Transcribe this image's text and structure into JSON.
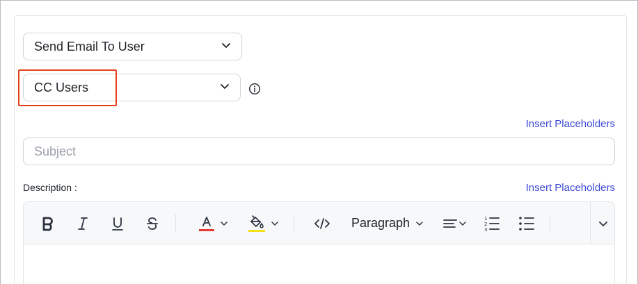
{
  "form": {
    "action_select": {
      "value": "Send Email To User"
    },
    "cc_select": {
      "value": "CC Users"
    },
    "subject": {
      "value": "",
      "placeholder": "Subject"
    },
    "subject_placeholders_link": "Insert Placeholders",
    "description_label": "Description :",
    "description_placeholders_link": "Insert Placeholders"
  },
  "toolbar": {
    "paragraph_label": "Paragraph",
    "text_color_accent": "#e53935",
    "highlight_color_accent": "#f4e01b"
  },
  "colors": {
    "link": "#3b47d6",
    "highlight_box": "#e4401c"
  }
}
